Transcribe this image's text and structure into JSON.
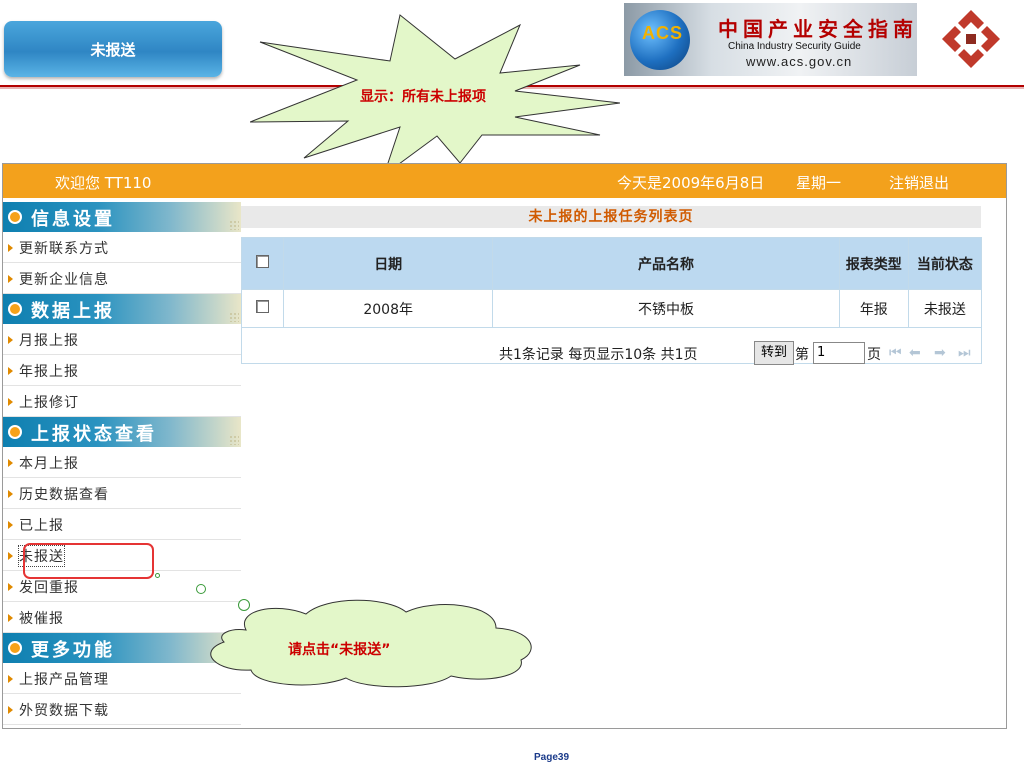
{
  "slide": {
    "tab_title": "未报送",
    "callout_star": "显示：所有未上报项",
    "callout_cloud": "请点击“未报送”",
    "footer": "Page39"
  },
  "banner": {
    "logo_text": "ACS",
    "cn_title": "中国产业安全指南",
    "en_title": "China Industry Security Guide",
    "url": "www.acs.gov.cn"
  },
  "topbar": {
    "welcome": "欢迎您 TT110",
    "today": "今天是2009年6月8日",
    "weekday": "星期一",
    "logout": "注销退出"
  },
  "sidebar": {
    "sections": [
      {
        "title": "信息设置",
        "items": [
          "更新联系方式",
          "更新企业信息"
        ]
      },
      {
        "title": "数据上报",
        "items": [
          "月报上报",
          "年报上报",
          "上报修订"
        ]
      },
      {
        "title": "上报状态查看",
        "items": [
          "本月上报",
          "历史数据查看",
          "已上报",
          "未报送",
          "发回重报",
          "被催报"
        ]
      },
      {
        "title": "更多功能",
        "items": [
          "上报产品管理",
          "外贸数据下载"
        ]
      }
    ],
    "current_item": "未报送"
  },
  "main": {
    "list_title": "未上报的上报任务列表页",
    "columns": [
      "日期",
      "产品名称",
      "报表类型",
      "当前状态"
    ],
    "rows": [
      {
        "date": "2008年",
        "product": "不锈中板",
        "report_type": "年报",
        "status": "未报送"
      }
    ],
    "pager": {
      "summary": "共1条记录  每页显示10条  共1页",
      "goto_label": "转到",
      "page_prefix": "第",
      "page_value": "1",
      "page_suffix": "页"
    }
  },
  "colors": {
    "topbar": "#f3a11c",
    "section_header": "#0e7fb0",
    "table_header": "#bcd9f0",
    "highlight": "#e53434",
    "callout_text": "#cc0000"
  }
}
